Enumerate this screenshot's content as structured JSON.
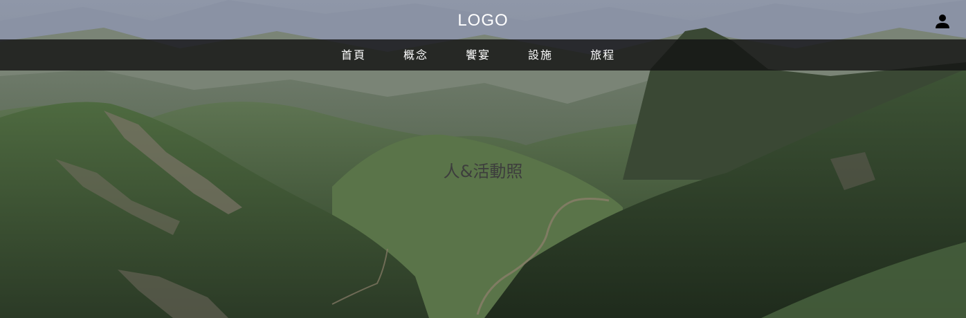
{
  "header": {
    "logo_text": "LOGO",
    "user_icon": "user-icon"
  },
  "nav": {
    "items": [
      {
        "label": "首頁"
      },
      {
        "label": "概念"
      },
      {
        "label": "饗宴"
      },
      {
        "label": "設施"
      },
      {
        "label": "旅程"
      }
    ]
  },
  "hero": {
    "caption": "人&活動照",
    "image_subject": "green mountain valley landscape"
  },
  "colors": {
    "nav_background": "#141414",
    "nav_text": "#ffffff",
    "logo_text": "#ffffff",
    "caption_text": "#3d3d3d"
  }
}
